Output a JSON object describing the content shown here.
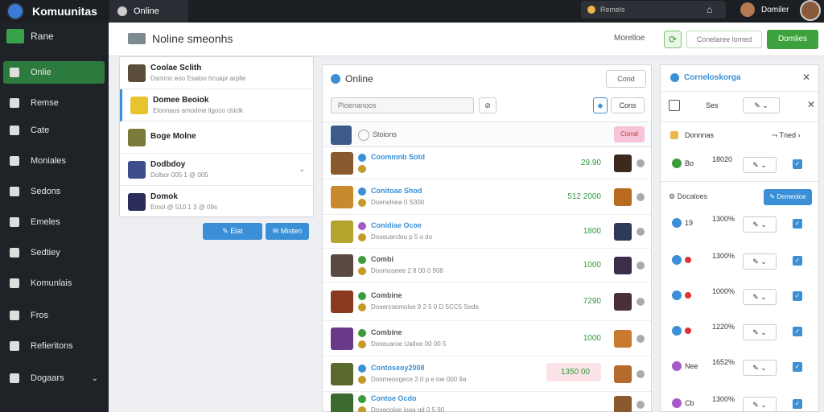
{
  "topbar": {
    "brand": "Komuunitas",
    "online_label": "Online",
    "search_placeholder": "Remels",
    "user_name": "Domiler"
  },
  "sidebar": {
    "home_label": "Rane",
    "items": [
      {
        "label": "Onlie",
        "icon": "home-icon",
        "active": true
      },
      {
        "label": "Remse",
        "icon": "bell-icon"
      },
      {
        "label": "Cate",
        "icon": "chat-icon"
      },
      {
        "label": "Moniales",
        "icon": "grid-icon"
      },
      {
        "label": "Sedons",
        "icon": "tools-icon"
      },
      {
        "label": "Emeles",
        "icon": "group-icon"
      },
      {
        "label": "Sedtiey",
        "icon": "doc-icon"
      },
      {
        "label": "Komunlais",
        "icon": "list-icon"
      },
      {
        "label": "Fros",
        "icon": "bulb-icon"
      },
      {
        "label": "Refieritons",
        "icon": "lock-icon"
      },
      {
        "label": "Dogaars",
        "icon": "avatar-icon"
      }
    ]
  },
  "header": {
    "title": "Noline smeonhs",
    "notes_label": "Morelloe",
    "search_placeholder": "Conelaree lomed",
    "primary_button": "Domlies"
  },
  "chats": [
    {
      "name": "Coolae Sclith",
      "msg": "Dsmroc eoo Esaloo hcuapr arplle",
      "thumb": "#5a4e3a"
    },
    {
      "name": "Domee Beoiok",
      "msg": "Elonnaus amodme llgoco chiclk",
      "thumb": "#e8c52f"
    },
    {
      "name": "Boge Molne",
      "msg": "",
      "thumb": "#7a7a3a"
    },
    {
      "name": "Dodbdoy",
      "msg": "Dolbor 005 1 @ 005",
      "thumb": "#3c4f8a"
    },
    {
      "name": "Domok",
      "msg": "Emol @ 510 1 3 @ 09s",
      "thumb": "#2b2e5a"
    }
  ],
  "chat_buttons": {
    "left": "Elat",
    "right": "Misten"
  },
  "middle": {
    "title": "Online",
    "code_button": "Cond",
    "search_placeholder": "Ploenanoos",
    "select_label": "Cons",
    "header_label": "Stoions",
    "header_badge": "Corral",
    "rows": [
      {
        "name": "Coommnb Sotd",
        "sub": "",
        "value": "29.90",
        "name_color": "#3a8fd6",
        "s1": "#3a8fd6",
        "thumb": "#8a5a2e",
        "rthumb": "#3c2a1e",
        "pink": false
      },
      {
        "name": "Conitoae Shod",
        "sub": "Doenelnea 0 S300",
        "value": "512 2000",
        "name_color": "#3a8fd6",
        "s1": "#3a8fd6",
        "thumb": "#c98a2e",
        "rthumb": "#b86a1e",
        "pink": false
      },
      {
        "name": "Conidiae Ocoe",
        "sub": "Doseuarcleu p 5 o do",
        "value": "1800",
        "name_color": "#3a8fd6",
        "s1": "#a55ac7",
        "thumb": "#b5a52e",
        "rthumb": "#2e3a5a",
        "pink": false
      },
      {
        "name": "Combi",
        "sub": "Doomoseee 2 8 00 0 908",
        "value": "1000",
        "name_color": "#555",
        "s1": "#3a9b3a",
        "thumb": "#5a4a42",
        "rthumb": "#3a2e4a",
        "pink": false
      },
      {
        "name": "Combine",
        "sub": "Dosercoomolse 9 2 5 0 D 5CC5 Sedo",
        "value": "7290",
        "name_color": "#555",
        "s1": "#3a9b3a",
        "thumb": "#8a3a1e",
        "rthumb": "#4a2e3a",
        "pink": false
      },
      {
        "name": "Combine",
        "sub": "Doseuaroe Uatloe 00 00 5",
        "value": "1000",
        "name_color": "#555",
        "s1": "#3a9b3a",
        "thumb": "#6a3a8a",
        "rthumb": "#c97a2e",
        "pink": false
      },
      {
        "name": "Contoseoy2008",
        "sub": "Doomeoogece 2 0 p e ioe 000 9a",
        "value": "1350 00",
        "name_color": "#3a8fd6",
        "s1": "#3a8fd6",
        "thumb": "#5a6a2e",
        "rthumb": "#b56a2e",
        "pink": true
      },
      {
        "name": "Contoe Ocdo",
        "sub": "Doseooloe iooa gd 0 5 90",
        "value": "",
        "name_color": "#3a8fd6",
        "s1": "#3a9b3a",
        "thumb": "#3a6a2e",
        "rthumb": "#8a5a2e",
        "pink": false
      }
    ]
  },
  "right": {
    "title": "Corneloskorga",
    "row_label": "Ses",
    "section_label": "Donnnas",
    "next_label": "Tned",
    "first_row": {
      "label": "Bo",
      "pct": "18020"
    },
    "dir_title": "Docaloes",
    "dir_button": "Demeoloe",
    "rows": [
      {
        "label": "19",
        "pct": "1300%",
        "color": "#3a8fd6",
        "red": false
      },
      {
        "label": "",
        "pct": "1300%",
        "color": "#3a8fd6",
        "red": true
      },
      {
        "label": "",
        "pct": "1000%",
        "color": "#3a8fd6",
        "red": true
      },
      {
        "label": "",
        "pct": "1220%",
        "color": "#3a8fd6",
        "red": true
      },
      {
        "label": "Nee",
        "pct": "1652%",
        "color": "#a55ac7",
        "red": false
      },
      {
        "label": "Cb",
        "pct": "1300%",
        "color": "#a55ac7",
        "red": false
      }
    ]
  }
}
